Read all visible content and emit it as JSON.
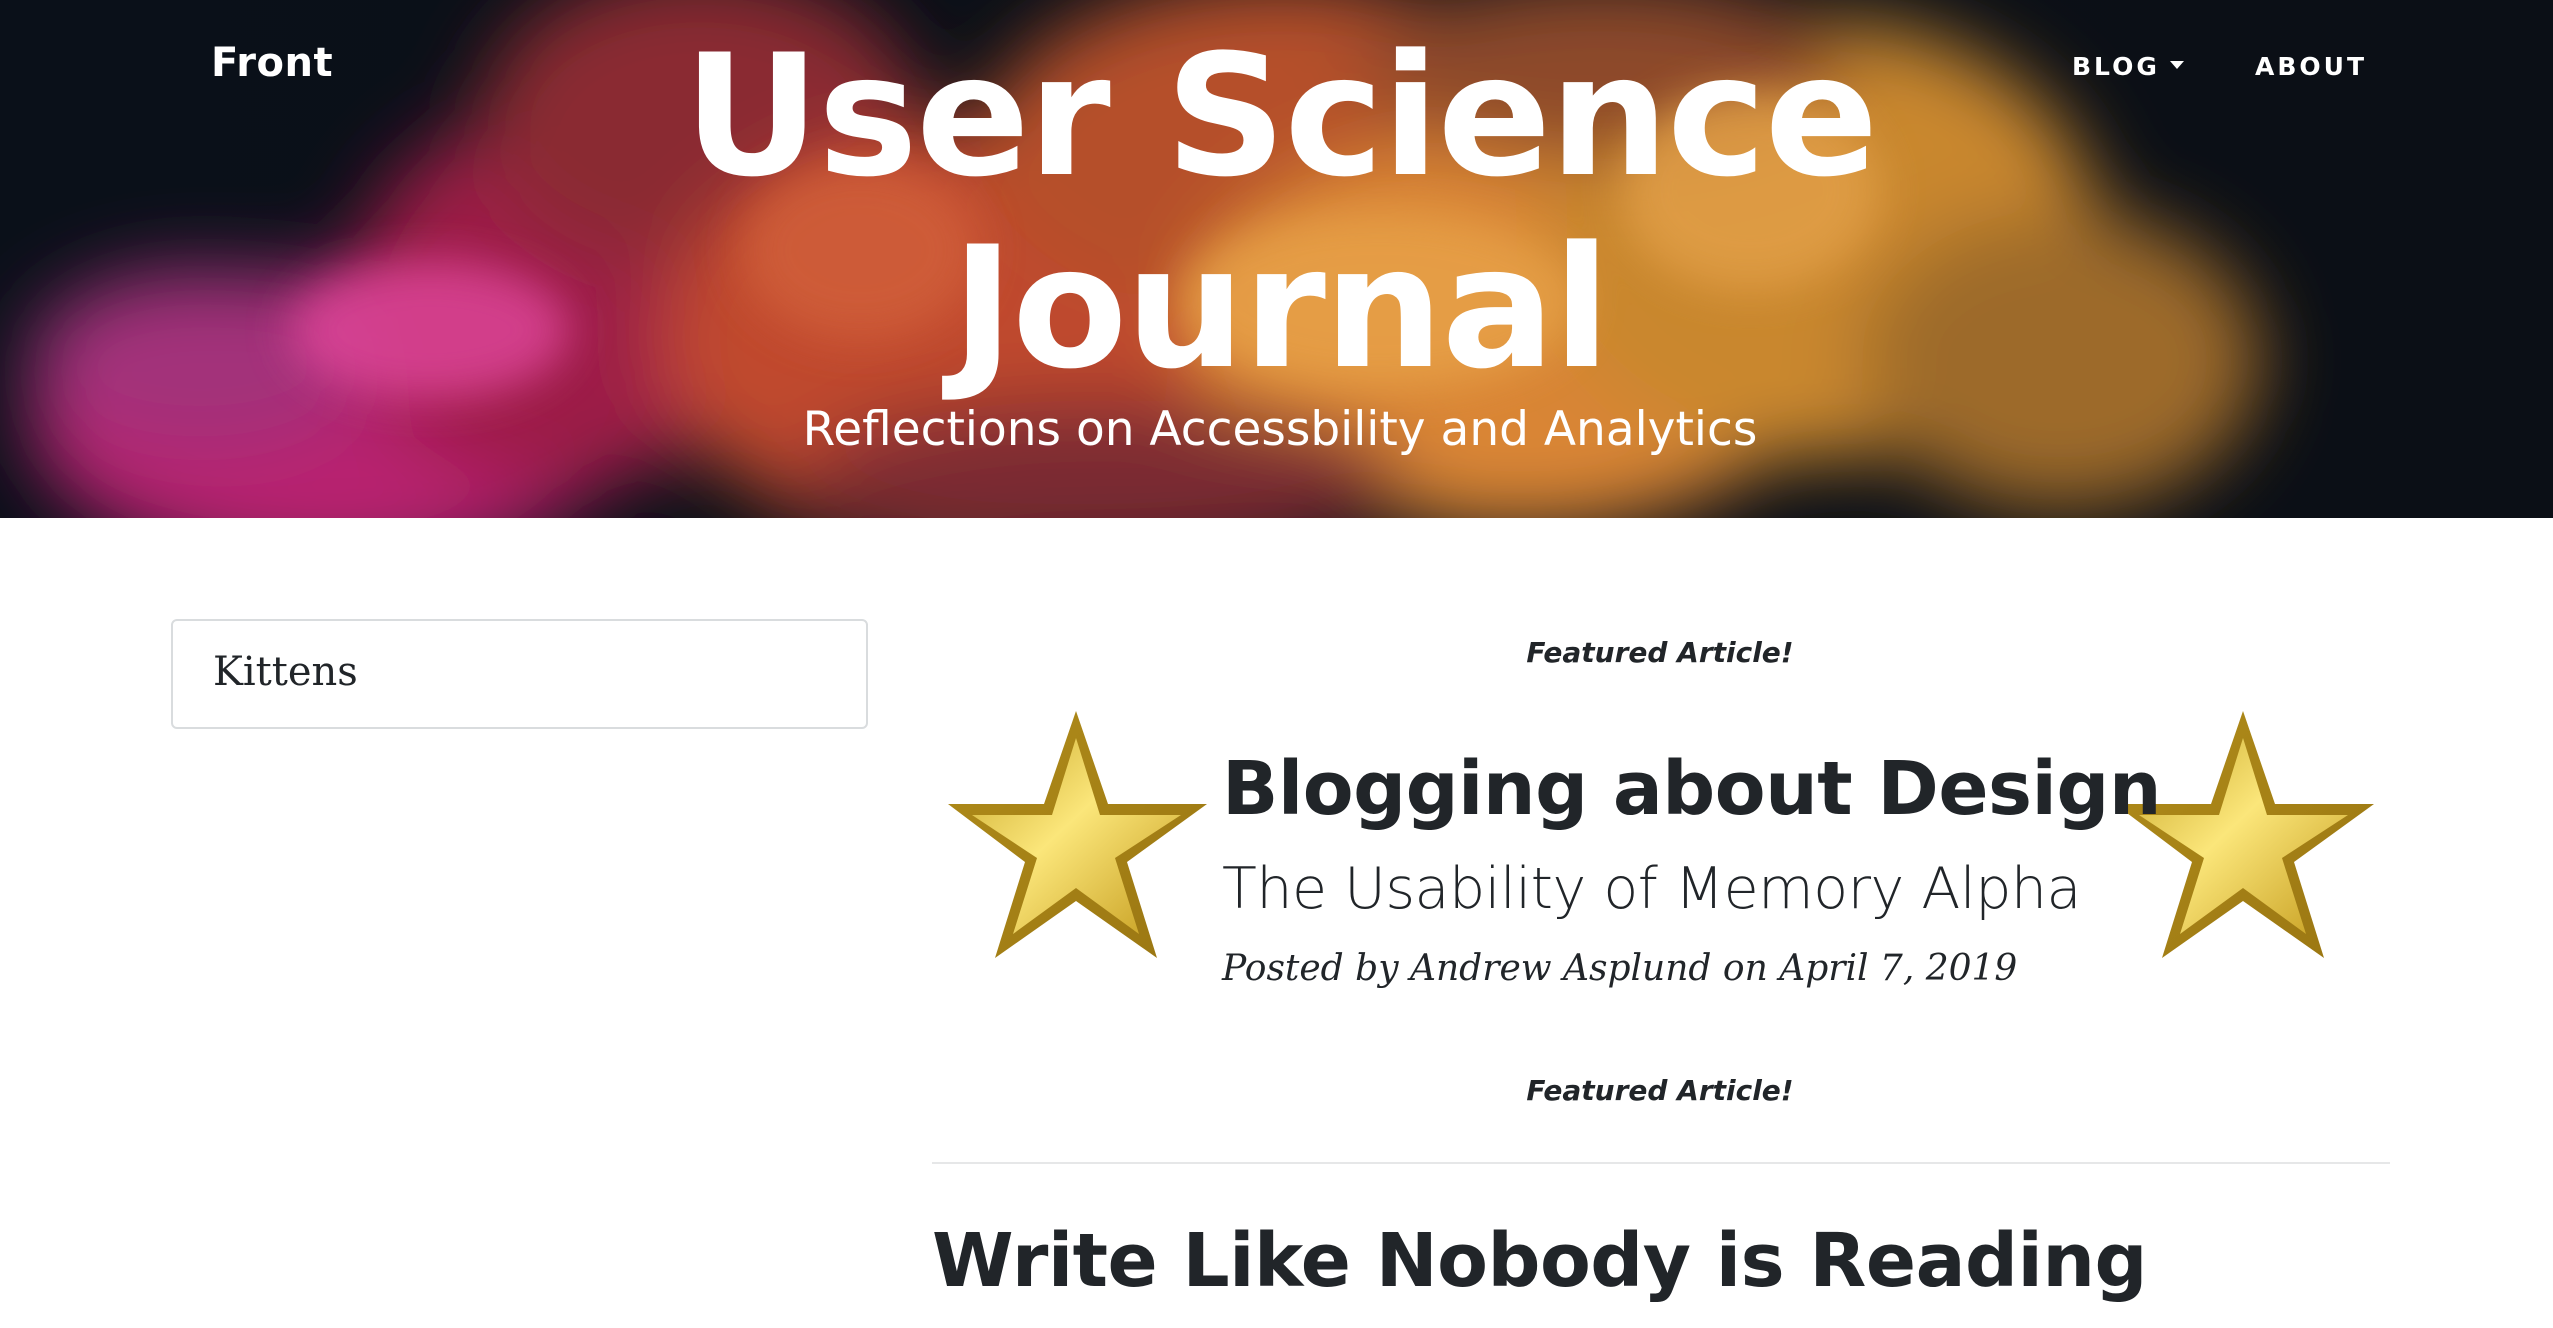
{
  "navbar": {
    "brand": "Front",
    "blog_label": "BLOG",
    "about_label": "ABOUT"
  },
  "header": {
    "title_line1": "User Science",
    "title_line2": "Journal",
    "subtitle": "Reflections on Accessbility and Analytics"
  },
  "sidebar": {
    "items": [
      {
        "label": "Kittens"
      }
    ]
  },
  "featured": {
    "label_top": "Featured Article!",
    "label_bottom": "Featured Article!",
    "title": "Blogging about Design",
    "subtitle": "The Usability of Memory Alpha",
    "meta_prefix": "Posted by ",
    "author": "Andrew Asplund",
    "meta_on": " on ",
    "date": "April 7, 2019",
    "icon": "gold-star-icon"
  },
  "posts": [
    {
      "title": "Write Like Nobody is Reading"
    }
  ],
  "colors": {
    "text": "#212529",
    "star_gold": "#e8c23a",
    "divider": "#e6e7e8"
  }
}
